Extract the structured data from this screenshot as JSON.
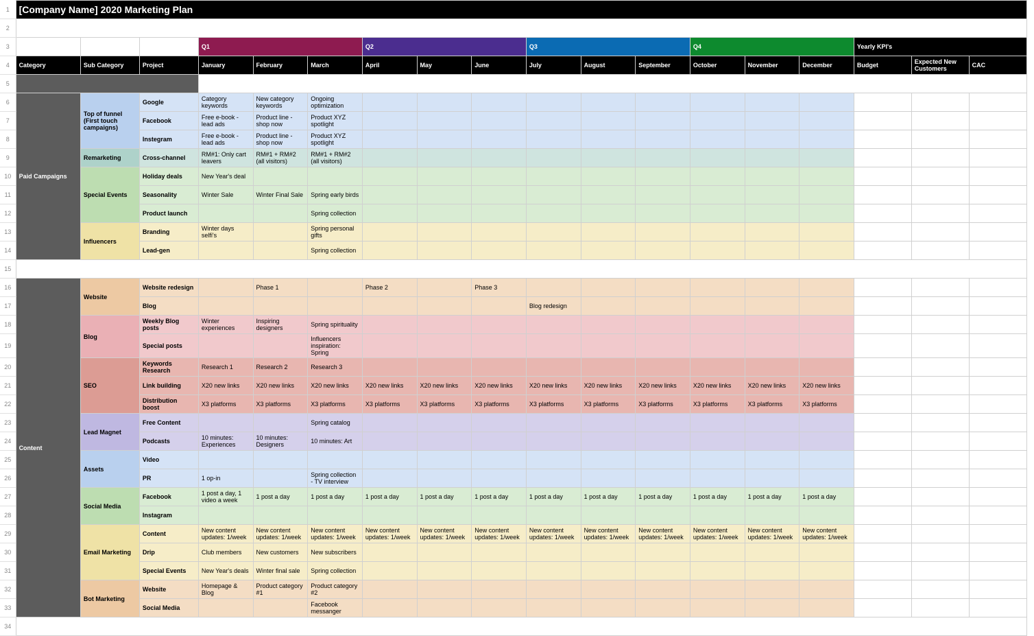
{
  "title": "[Company Name] 2020 Marketing Plan",
  "quarters": [
    "Q1",
    "Q2",
    "Q3",
    "Q4"
  ],
  "kpiHeader": "Yearly KPI's",
  "headers": {
    "cat": "Category",
    "sub": "Sub Category",
    "proj": "Project",
    "months": [
      "January",
      "February",
      "March",
      "April",
      "May",
      "June",
      "July",
      "August",
      "September",
      "October",
      "November",
      "December"
    ],
    "kpis": [
      "Budget",
      "Expected New Customers",
      "CAC"
    ]
  },
  "rows": [
    {
      "n": 6,
      "cat": "Paid Campaigns",
      "sub": "Top of funnel (First touch campaigns)",
      "subCls": "s-lblue",
      "subSpan": 3,
      "proj": "Google",
      "cls": "b-lblue",
      "m": [
        "Category keywords",
        "New category keywords",
        "Ongoing optimization",
        "",
        "",
        "",
        "",
        "",
        "",
        "",
        "",
        ""
      ]
    },
    {
      "n": 7,
      "proj": "Facebook",
      "cls": "b-lblue",
      "m": [
        "Free e-book - lead ads",
        "Product line - shop now",
        "Product XYZ spotlight",
        "",
        "",
        "",
        "",
        "",
        "",
        "",
        "",
        ""
      ]
    },
    {
      "n": 8,
      "proj": "Instegram",
      "cls": "b-lblue",
      "m": [
        "Free e-book - lead ads",
        "Product line - shop now",
        "Product XYZ spotlight",
        "",
        "",
        "",
        "",
        "",
        "",
        "",
        "",
        ""
      ]
    },
    {
      "n": 9,
      "sub": "Remarketing",
      "subCls": "s-teal",
      "subSpan": 1,
      "proj": "Cross-channel",
      "cls": "b-teal",
      "m": [
        "RM#1: Only cart leavers",
        "RM#1 + RM#2 (all visitors)",
        "RM#1 + RM#2 (all visitors)",
        "",
        "",
        "",
        "",
        "",
        "",
        "",
        "",
        ""
      ]
    },
    {
      "n": 10,
      "sub": "Special Events",
      "subCls": "s-lgreen",
      "subSpan": 3,
      "proj": "Holiday deals",
      "cls": "b-lgreen",
      "m": [
        "New Year's deal",
        "",
        "",
        "",
        "",
        "",
        "",
        "",
        "",
        "",
        "",
        ""
      ]
    },
    {
      "n": 11,
      "proj": "Seasonality",
      "cls": "b-lgreen",
      "m": [
        "Winter Sale",
        "Winter Final Sale",
        "Spring early birds",
        "",
        "",
        "",
        "",
        "",
        "",
        "",
        "",
        ""
      ]
    },
    {
      "n": 12,
      "proj": "Product launch",
      "cls": "b-lgreen",
      "m": [
        "",
        "",
        "Spring collection",
        "",
        "",
        "",
        "",
        "",
        "",
        "",
        "",
        ""
      ]
    },
    {
      "n": 13,
      "sub": "Influencers",
      "subCls": "s-cream",
      "subSpan": 2,
      "proj": "Branding",
      "cls": "b-cream",
      "m": [
        "Winter days selfi's",
        "",
        "Spring personal gifts",
        "",
        "",
        "",
        "",
        "",
        "",
        "",
        "",
        ""
      ]
    },
    {
      "n": 14,
      "proj": "Lead-gen",
      "cls": "b-cream",
      "m": [
        "",
        "",
        "Spring collection",
        "",
        "",
        "",
        "",
        "",
        "",
        "",
        "",
        ""
      ]
    },
    {
      "n": 16,
      "cat": "Content",
      "sub": "Website",
      "subCls": "s-peach",
      "subSpan": 2,
      "proj": "Website redesign",
      "cls": "b-peach",
      "m": [
        "",
        "Phase 1",
        "",
        "Phase 2",
        "",
        "Phase 3",
        "",
        "",
        "",
        "",
        "",
        ""
      ]
    },
    {
      "n": 17,
      "proj": "Blog",
      "cls": "b-peach",
      "m": [
        "",
        "",
        "",
        "",
        "",
        "",
        "Blog redesign",
        "",
        "",
        "",
        "",
        ""
      ]
    },
    {
      "n": 18,
      "sub": "Blog",
      "subCls": "s-pink",
      "subSpan": 2,
      "proj": "Weekly Blog posts",
      "cls": "b-pink",
      "m": [
        "Winter experiences",
        "Inspiring designers",
        "Spring spirituality",
        "",
        "",
        "",
        "",
        "",
        "",
        "",
        "",
        ""
      ]
    },
    {
      "n": 19,
      "proj": "Special posts",
      "cls": "b-pink",
      "m": [
        "",
        "",
        "Influencers inspiration: Spring",
        "",
        "",
        "",
        "",
        "",
        "",
        "",
        "",
        ""
      ]
    },
    {
      "n": 20,
      "sub": "SEO",
      "subCls": "s-salmon",
      "subSpan": 3,
      "proj": "Keywords Research",
      "cls": "b-salmon",
      "m": [
        "Research 1",
        "Research 2",
        "Research 3",
        "",
        "",
        "",
        "",
        "",
        "",
        "",
        "",
        ""
      ]
    },
    {
      "n": 21,
      "proj": "Link building",
      "cls": "b-salmon",
      "m": [
        "X20 new links",
        "X20 new links",
        "X20 new links",
        "X20 new links",
        "X20 new links",
        "X20 new links",
        "X20 new links",
        "X20 new links",
        "X20 new links",
        "X20 new links",
        "X20 new links",
        "X20 new links"
      ]
    },
    {
      "n": 22,
      "proj": "Distribution boost",
      "cls": "b-salmon",
      "m": [
        "X3 platforms",
        "X3 platforms",
        "X3 platforms",
        "X3 platforms",
        "X3 platforms",
        "X3 platforms",
        "X3 platforms",
        "X3 platforms",
        "X3 platforms",
        "X3 platforms",
        "X3 platforms",
        "X3 platforms"
      ]
    },
    {
      "n": 23,
      "sub": "Lead Magnet",
      "subCls": "s-lav",
      "subSpan": 2,
      "proj": "Free Content",
      "cls": "b-lav",
      "m": [
        "",
        "",
        "Spring catalog",
        "",
        "",
        "",
        "",
        "",
        "",
        "",
        "",
        ""
      ]
    },
    {
      "n": 24,
      "proj": "Podcasts",
      "cls": "b-lav",
      "m": [
        "10 minutes: Experiences",
        "10 minutes: Designers",
        "10 minutes: Art",
        "",
        "",
        "",
        "",
        "",
        "",
        "",
        "",
        ""
      ]
    },
    {
      "n": 25,
      "sub": "Assets",
      "subCls": "s-blue2",
      "subSpan": 2,
      "proj": "Video",
      "cls": "b-lblue",
      "m": [
        "",
        "",
        "",
        "",
        "",
        "",
        "",
        "",
        "",
        "",
        "",
        ""
      ]
    },
    {
      "n": 26,
      "proj": "PR",
      "cls": "b-lblue",
      "m": [
        "1 op-in",
        "",
        "Spring collection - TV interview",
        "",
        "",
        "",
        "",
        "",
        "",
        "",
        "",
        ""
      ]
    },
    {
      "n": 27,
      "sub": "Social Media",
      "subCls": "s-lgreen",
      "subSpan": 2,
      "proj": "Facebook",
      "cls": "b-lgreen",
      "m": [
        "1 post a day, 1 video a week",
        "1 post a day",
        "1 post a day",
        "1 post a day",
        "1 post a day",
        "1 post a day",
        "1 post a day",
        "1 post a day",
        "1 post a day",
        "1 post a day",
        "1 post a day",
        "1 post a day"
      ]
    },
    {
      "n": 28,
      "proj": "Instagram",
      "cls": "b-lgreen",
      "m": [
        "",
        "",
        "",
        "",
        "",
        "",
        "",
        "",
        "",
        "",
        "",
        ""
      ]
    },
    {
      "n": 29,
      "sub": "Email Marketing",
      "subCls": "s-cream",
      "subSpan": 3,
      "proj": "Content",
      "cls": "b-cream",
      "m": [
        "New content updates: 1/week",
        "New content updates: 1/week",
        "New content updates: 1/week",
        "New content updates: 1/week",
        "New content updates: 1/week",
        "New content updates: 1/week",
        "New content updates: 1/week",
        "New content updates: 1/week",
        "New content updates: 1/week",
        "New content updates: 1/week",
        "New content updates: 1/week",
        "New content updates: 1/week"
      ]
    },
    {
      "n": 30,
      "proj": "Drip",
      "cls": "b-cream",
      "m": [
        "Club members",
        "New customers",
        "New subscribers",
        "",
        "",
        "",
        "",
        "",
        "",
        "",
        "",
        ""
      ]
    },
    {
      "n": 31,
      "proj": "Special Events",
      "cls": "b-cream",
      "m": [
        "New Year's deals",
        "Winter final sale",
        "Spring collection",
        "",
        "",
        "",
        "",
        "",
        "",
        "",
        "",
        ""
      ]
    },
    {
      "n": 32,
      "sub": "Bot Marketing",
      "subCls": "s-peach",
      "subSpan": 2,
      "proj": "Website",
      "cls": "b-peach",
      "m": [
        "Homepage & Blog",
        "Product category #1",
        "Product category #2",
        "",
        "",
        "",
        "",
        "",
        "",
        "",
        "",
        ""
      ]
    },
    {
      "n": 33,
      "proj": "Social Media",
      "cls": "b-peach",
      "m": [
        "",
        "",
        "Facebook messanger",
        "",
        "",
        "",
        "",
        "",
        "",
        "",
        "",
        ""
      ]
    }
  ]
}
